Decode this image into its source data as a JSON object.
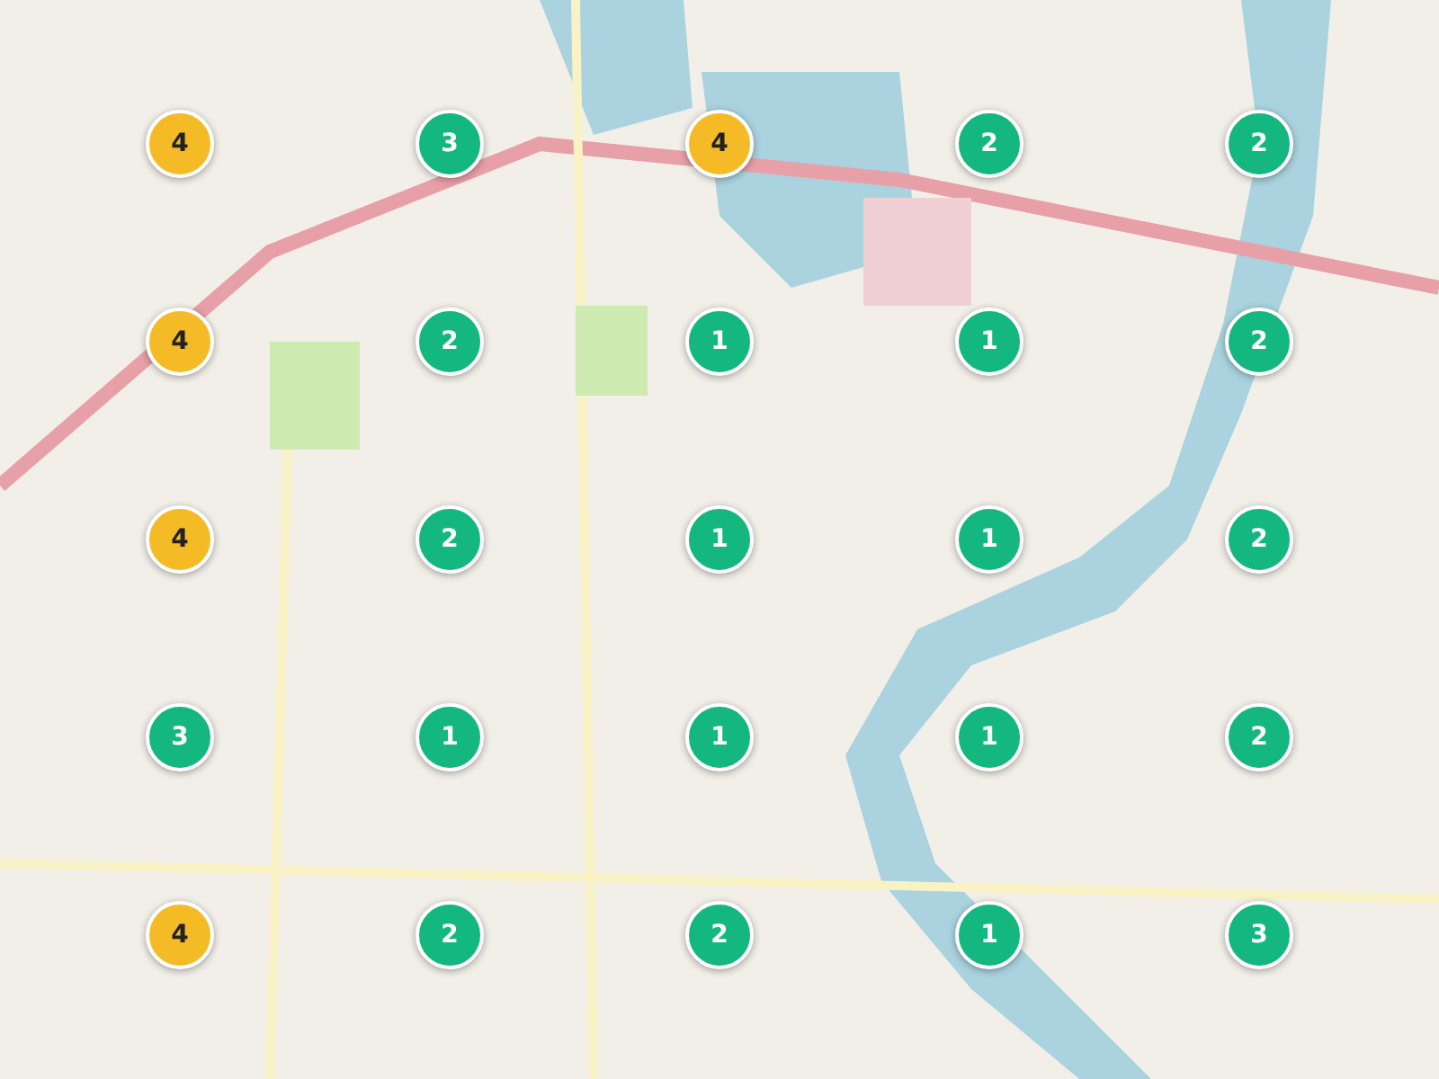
{
  "markers": [
    {
      "count": "4",
      "color": "#f5bb27"
    },
    {
      "count": "3",
      "color": "#14b77f"
    },
    {
      "count": "4",
      "color": "#f5bb27"
    },
    {
      "count": "2",
      "color": "#14b77f"
    },
    {
      "count": "2",
      "color": "#14b77f"
    },
    {
      "count": "4",
      "color": "#f5bb27"
    },
    {
      "count": "2",
      "color": "#14b77f"
    },
    {
      "count": "1",
      "color": "#14b77f"
    },
    {
      "count": "1",
      "color": "#14b77f"
    },
    {
      "count": "2",
      "color": "#14b77f"
    },
    {
      "count": "4",
      "color": "#f5bb27"
    },
    {
      "count": "2",
      "color": "#14b77f"
    },
    {
      "count": "1",
      "color": "#14b77f"
    },
    {
      "count": "1",
      "color": "#14b77f"
    },
    {
      "count": "2",
      "color": "#14b77f"
    },
    {
      "count": "3",
      "color": "#14b77f"
    },
    {
      "count": "1",
      "color": "#14b77f"
    },
    {
      "count": "1",
      "color": "#14b77f"
    },
    {
      "count": "1",
      "color": "#14b77f"
    },
    {
      "count": "2",
      "color": "#14b77f"
    },
    {
      "count": "4",
      "color": "#f5bb27"
    },
    {
      "count": "2",
      "color": "#14b77f"
    },
    {
      "count": "2",
      "color": "#14b77f"
    },
    {
      "count": "1",
      "color": "#14b77f"
    },
    {
      "count": "3",
      "color": "#14b77f"
    }
  ]
}
